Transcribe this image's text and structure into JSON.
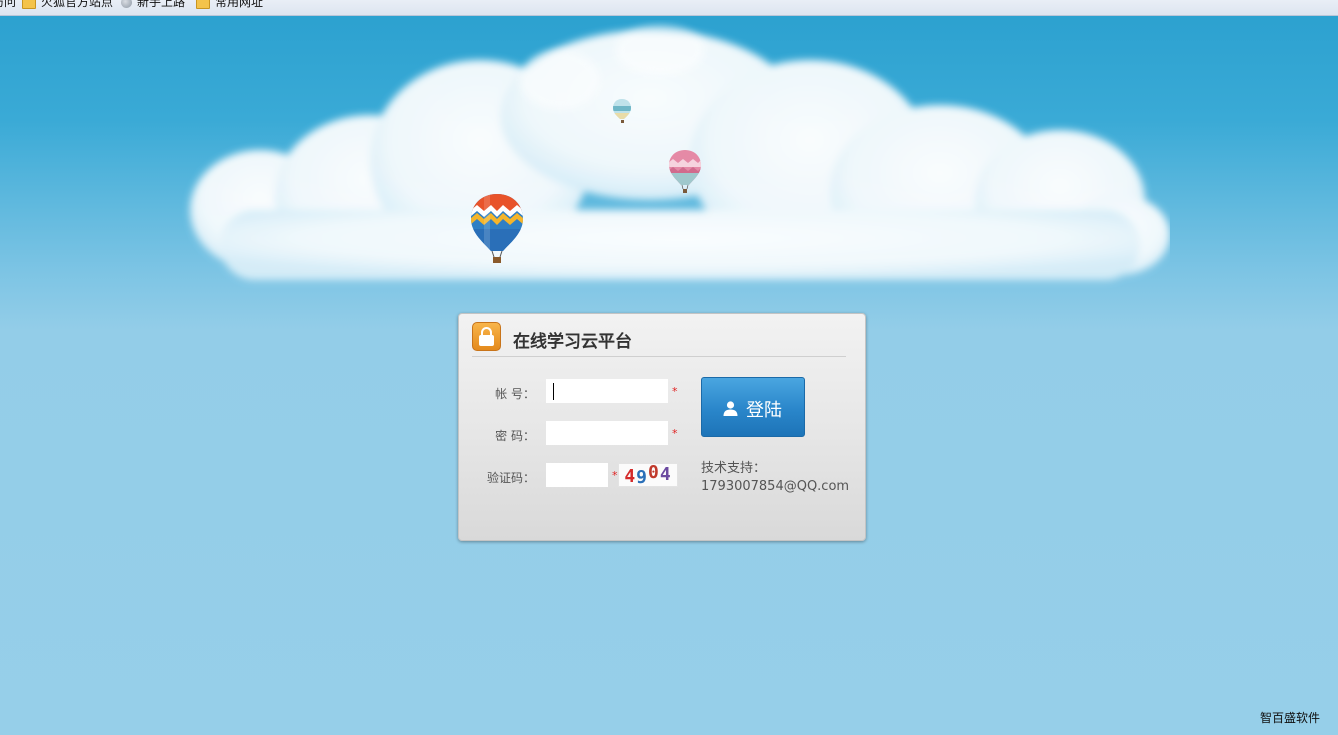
{
  "bookmarks": {
    "items": [
      {
        "label": "访问",
        "icon": "folder-icon"
      },
      {
        "label": "火狐官方站点",
        "icon": "folder-icon"
      },
      {
        "label": "新手上路",
        "icon": "globe-icon"
      },
      {
        "label": "常用网址",
        "icon": "folder-icon"
      }
    ]
  },
  "login": {
    "title": "在线学习云平台",
    "account_label": "帐 号：",
    "account_value": "",
    "password_label": "密 码：",
    "password_value": "",
    "captcha_label": "验证码：",
    "captcha_value": "",
    "captcha_chars": [
      "4",
      "9",
      "0",
      "4"
    ],
    "captcha_colors": [
      "#d42a2a",
      "#2a6fb8",
      "#c0392b",
      "#6b4aa0"
    ],
    "required_mark": "*",
    "login_button": "登陆",
    "support_label": "技术支持：",
    "support_contact": "1793007854@QQ.com"
  },
  "footer": {
    "brand": "智百盛软件"
  },
  "colors": {
    "sky_top": "#2aa0cf",
    "sky_bottom": "#96cfe9",
    "button_blue": "#2a86ca",
    "lock_orange": "#f0a030"
  }
}
